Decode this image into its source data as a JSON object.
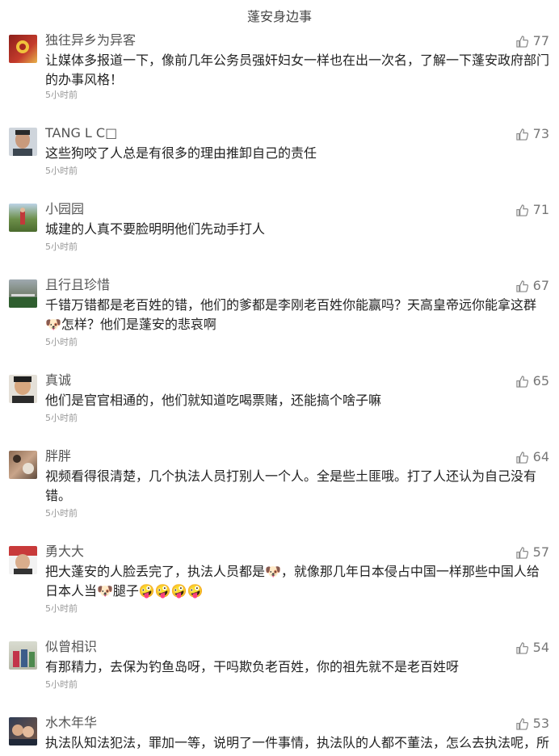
{
  "header": {
    "title": "蓬安身边事"
  },
  "comments": [
    {
      "name": "独往异乡为异客",
      "likes": "77",
      "content": "让媒体多报道一下，像前几年公务员强奸妇女一样也在出一次名，了解一下蓬安政府部门的办事风格！",
      "time": "5小时前"
    },
    {
      "name": "TANG L C□",
      "likes": "73",
      "content": "这些狗咬了人总是有很多的理由推卸自己的责任",
      "time": "5小时前"
    },
    {
      "name": "小园园",
      "likes": "71",
      "content": "城建的人真不要脸明明他们先动手打人",
      "time": "5小时前"
    },
    {
      "name": "且行且珍惜",
      "likes": "67",
      "content": "千错万错都是老百姓的错，他们的爹都是李刚老百姓你能赢吗？天高皇帝远你能拿这群🐶怎样？他们是蓬安的悲哀啊",
      "time": "5小时前"
    },
    {
      "name": "真诚",
      "likes": "65",
      "content": "他们是官官相通的，他们就知道吃喝票赌，还能搞个啥子嘛",
      "time": "5小时前"
    },
    {
      "name": "胖胖",
      "likes": "64",
      "content": "视频看得很清楚，几个执法人员打别人一个人。全是些土匪哦。打了人还认为自己没有错。",
      "time": "5小时前"
    },
    {
      "name": "勇大大",
      "likes": "57",
      "content": "把大蓬安的人脸丢完了，执法人员都是🐶，就像那几年日本侵占中国一样那些中国人给日本人当🐶腿子🤪🤪🤪🤪",
      "time": "5小时前"
    },
    {
      "name": "似曾相识",
      "likes": "54",
      "content": "有那精力，去保为钓鱼岛呀，干吗欺负老百姓，你的祖先就不是老百姓呀",
      "time": "5小时前"
    },
    {
      "name": "水木年华",
      "likes": "53",
      "content": "执法队知法犯法，罪加一等，说明了一件事情，执法队的人都不董法，怎么去执法呢，所",
      "time": ""
    }
  ],
  "icons": {
    "like": "thumbs-up-icon"
  },
  "colors": {
    "text": "#222222",
    "meta": "#999999",
    "name": "#555555"
  }
}
